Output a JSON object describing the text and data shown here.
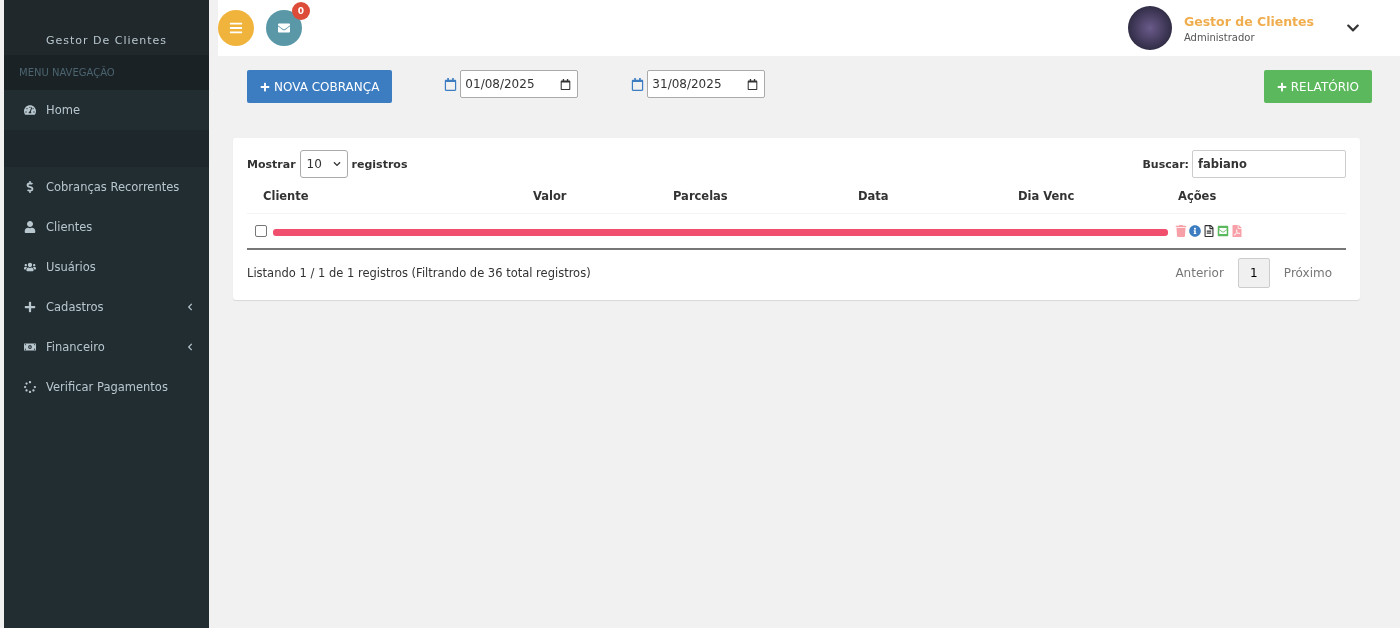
{
  "sidebar": {
    "brand": "Gestor De Clientes",
    "menu_header": "MENU NAVEGAÇÃO",
    "items": [
      {
        "kind": "home",
        "label": "Home",
        "expandable": false
      },
      {
        "kind": "dollar",
        "label": "Cobranças Recorrentes",
        "expandable": false
      },
      {
        "kind": "user",
        "label": "Clientes",
        "expandable": false
      },
      {
        "kind": "users",
        "label": "Usuários",
        "expandable": false
      },
      {
        "kind": "plus",
        "label": "Cadastros",
        "expandable": true
      },
      {
        "kind": "money",
        "label": "Financeiro",
        "expandable": true
      },
      {
        "kind": "spinner",
        "label": "Verificar Pagamentos",
        "expandable": false
      }
    ]
  },
  "header": {
    "notifications": "0",
    "user": {
      "name": "Gestor de Clientes",
      "role": "Administrador"
    }
  },
  "toolbar": {
    "new_button": "NOVA COBRANÇA",
    "date_from": "01/08/2025",
    "date_to": "31/08/2025",
    "report_button": "RELATÓRIO"
  },
  "table": {
    "show_label": "Mostrar",
    "page_size": "10",
    "show_suffix": "registros",
    "search_label": "Buscar:",
    "search_value": "fabiano",
    "columns": [
      "Cliente",
      "Valor",
      "Parcelas",
      "Data",
      "Dia Venc",
      "Ações"
    ],
    "rows": [
      {
        "checked": false,
        "redacted": true
      }
    ],
    "info": "Listando 1 / 1 de 1 registros (Filtrando de 36 total registros)",
    "pagination": {
      "previous": "Anterior",
      "pages": [
        {
          "label": "1",
          "selected": true
        }
      ],
      "next": "Próximo"
    }
  }
}
